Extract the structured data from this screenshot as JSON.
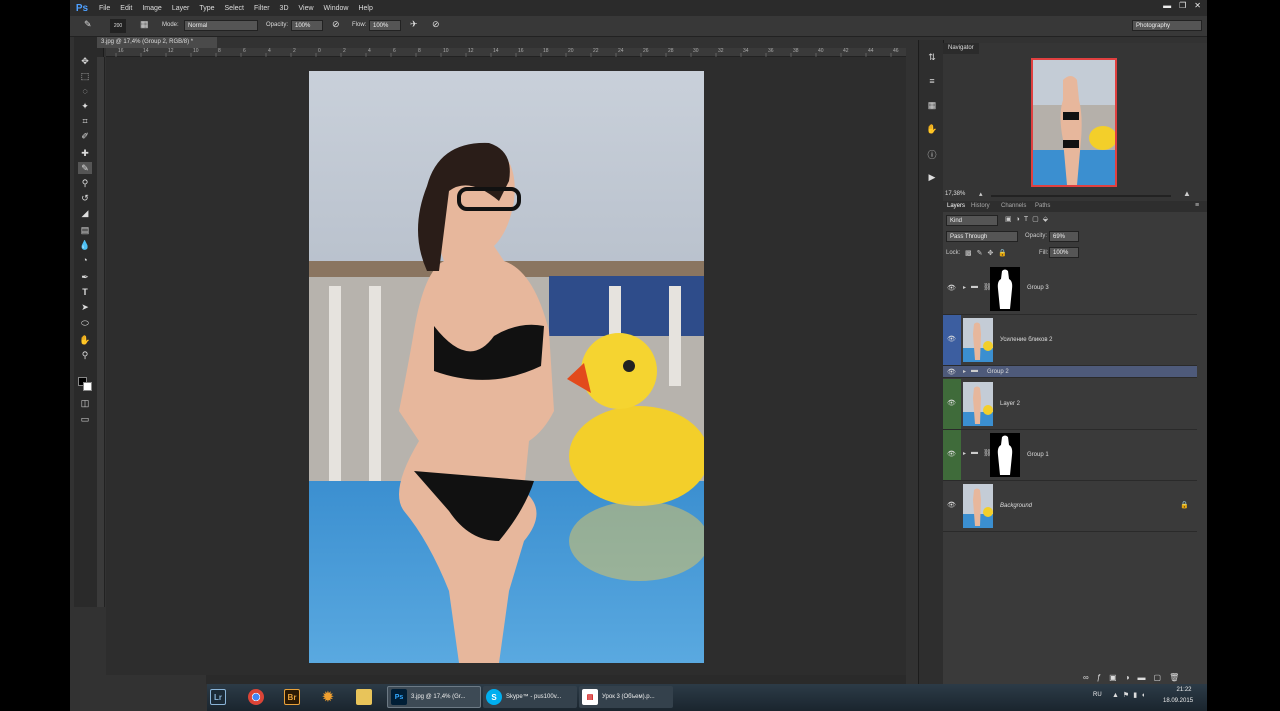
{
  "app": {
    "logo": "Ps",
    "menu": [
      "File",
      "Edit",
      "Image",
      "Layer",
      "Type",
      "Select",
      "Filter",
      "3D",
      "View",
      "Window",
      "Help"
    ],
    "workspace": "Photography"
  },
  "options": {
    "brush_size": "200",
    "mode_label": "Mode:",
    "mode_value": "Normal",
    "opacity_label": "Opacity:",
    "opacity_value": "100%",
    "flow_label": "Flow:",
    "flow_value": "100%"
  },
  "document": {
    "tab_title": "3.jpg @ 17,4% (Group 2, RGB/8) *",
    "ruler_ticks": [
      "16",
      "14",
      "12",
      "10",
      "8",
      "6",
      "4",
      "2",
      "0",
      "2",
      "4",
      "6",
      "8",
      "10",
      "12",
      "14",
      "16",
      "18",
      "20",
      "22",
      "24",
      "26",
      "28",
      "30",
      "32",
      "34",
      "36",
      "38",
      "40",
      "42",
      "44",
      "46",
      "48"
    ]
  },
  "navigator": {
    "title": "Navigator",
    "zoom": "17,38%"
  },
  "layers": {
    "tabs": [
      "Layers",
      "History",
      "Channels",
      "Paths"
    ],
    "filter_kind": "Kind",
    "blend_mode": "Pass Through",
    "opacity_label": "Opacity:",
    "opacity_value": "69%",
    "lock_label": "Lock:",
    "fill_label": "Fill:",
    "fill_value": "100%",
    "items": [
      {
        "name": "Group 3"
      },
      {
        "name": "Усиление бликов 2"
      },
      {
        "name": "Group 2"
      },
      {
        "name": "Layer 2"
      },
      {
        "name": "Group 1"
      },
      {
        "name": "Background"
      }
    ]
  },
  "taskbar": {
    "apps": [
      {
        "label": "Lr"
      },
      {
        "label": ""
      },
      {
        "label": "Br"
      },
      {
        "label": ""
      },
      {
        "label": ""
      },
      {
        "label": "3.jpg @ 17,4% (Gr..."
      },
      {
        "label": "Skype™ - pus100v..."
      },
      {
        "label": "Урок 3 (Объем).p..."
      }
    ],
    "lang": "RU",
    "time": "21:22",
    "date": "18.09.2015"
  },
  "colors": {
    "selected_layer": "#4e5a7a",
    "blue_marker": "#3c5ea0",
    "green_marker": "#3f6b3a"
  }
}
